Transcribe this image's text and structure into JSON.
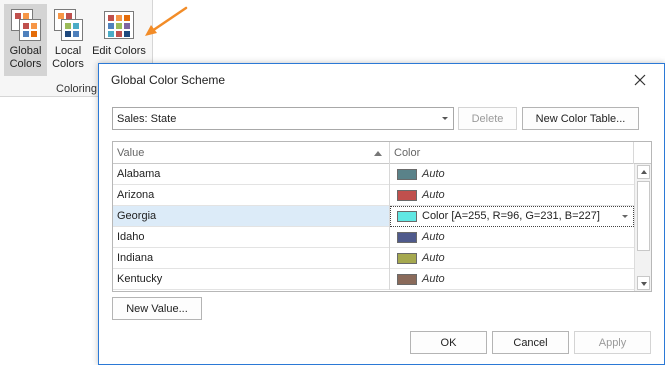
{
  "ribbon": {
    "buttons": [
      {
        "label_line1": "Global",
        "label_line2": "Colors",
        "icon": "global-colors-icon",
        "active": true
      },
      {
        "label_line1": "Local",
        "label_line2": "Colors",
        "icon": "local-colors-icon",
        "active": false
      },
      {
        "label_line1": "Edit Colors",
        "label_line2": "",
        "icon": "edit-colors-icon",
        "active": false
      }
    ],
    "group_label": "Coloring"
  },
  "annotation": {
    "arrow_color": "#f28c28"
  },
  "dialog": {
    "title": "Global Color Scheme",
    "close_icon": "close-icon",
    "table_select": "Sales: State",
    "delete_label": "Delete",
    "new_table_label": "New Color Table...",
    "grid": {
      "columns": [
        "Value",
        "Color"
      ],
      "rows": [
        {
          "value": "Alabama",
          "color_text": "Auto",
          "swatch": "#5a8289"
        },
        {
          "value": "Arizona",
          "color_text": "Auto",
          "swatch": "#c0504d"
        },
        {
          "value": "Georgia",
          "color_text": "Color [A=255, R=96, G=231, B=227]",
          "swatch": "#60e7e3",
          "selected": true
        },
        {
          "value": "Idaho",
          "color_text": "Auto",
          "swatch": "#4f5a8c"
        },
        {
          "value": "Indiana",
          "color_text": "Auto",
          "swatch": "#a5a84f"
        },
        {
          "value": "Kentucky",
          "color_text": "Auto",
          "swatch": "#8a6a5a"
        }
      ]
    },
    "new_value_label": "New Value...",
    "ok_label": "OK",
    "cancel_label": "Cancel",
    "apply_label": "Apply"
  }
}
